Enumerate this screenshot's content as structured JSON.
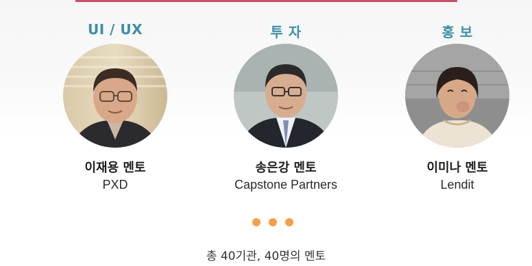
{
  "mentors": [
    {
      "category": "UI / UX",
      "name": "이재용 멘토",
      "company": "PXD",
      "photo_icon": "mentor-photo-icon"
    },
    {
      "category": "투 자",
      "name": "송은강 멘토",
      "company": "Capstone Partners",
      "photo_icon": "mentor-photo-icon"
    },
    {
      "category": "홍 보",
      "name": "이미나 멘토",
      "company": "Lendit",
      "photo_icon": "mentor-photo-icon"
    }
  ],
  "carousel": {
    "dot_count": 3,
    "dot_color": "#f3a04a"
  },
  "summary": "총 40기관, 40명의 멘토",
  "colors": {
    "accent_bar": "#c8506a",
    "category_text": "#3e8fa6"
  }
}
